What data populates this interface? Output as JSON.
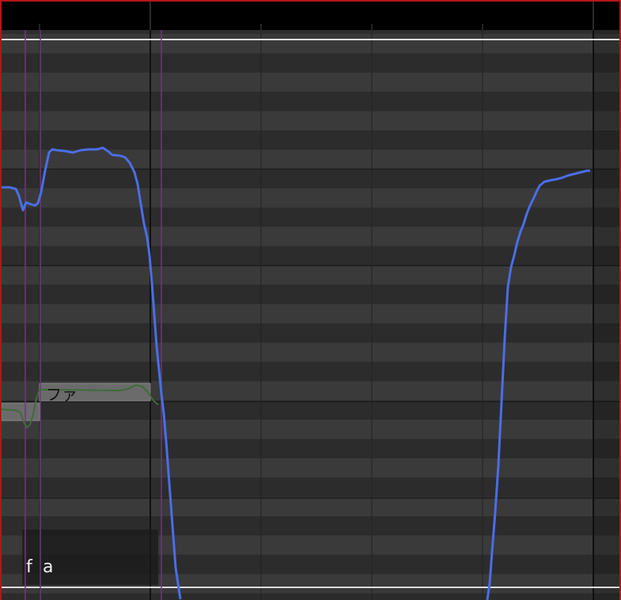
{
  "note": {
    "lyric": "ファ",
    "phonemes": [
      "f",
      "a"
    ]
  },
  "colors": {
    "background": "#000000",
    "row_light": "#3a3a3a",
    "row_dark": "#2c2c2c",
    "note_fill": "#6b6b6b",
    "pitch_curve": "#4a6ee8",
    "pitch_automation": "#3f6b3a",
    "phoneme_marker": "#6a3a7a",
    "frame_border": "#b01818"
  }
}
